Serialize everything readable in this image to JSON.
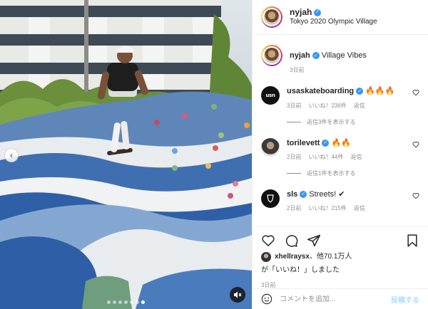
{
  "post": {
    "username": "nyjah",
    "location": "Tokyo 2020 Olympic Village",
    "caption": "Village Vibes",
    "caption_time": "3日前"
  },
  "comments": [
    {
      "username": "usaskateboarding",
      "avatar_text": "usn",
      "text": "🔥🔥🔥",
      "time": "3日前",
      "likes": "いいね！236件",
      "reply": "返信",
      "view_replies": "返信3件を表示する"
    },
    {
      "username": "torilevett",
      "text": "🔥🔥",
      "time": "2日前",
      "likes": "いいね！44件",
      "reply": "返信",
      "view_replies": "返信1件を表示する"
    },
    {
      "username": "sls",
      "text": "Streets! ✔",
      "time": "2日前",
      "likes": "いいね！215件",
      "reply": "返信"
    }
  ],
  "engagement": {
    "liker": "xhellraysx",
    "others": "、他70.1万人",
    "liked_suffix": "が「いいね！」しました",
    "post_time": "3日前"
  },
  "comment_box": {
    "placeholder": "コメントを追加...",
    "post_label": "投稿する"
  },
  "carousel": {
    "slide_count": 7,
    "active_index": 6
  },
  "colors": {
    "verified": "#3897f0",
    "post_button": "#b2dffc",
    "muted_text": "#8e8e8e"
  }
}
